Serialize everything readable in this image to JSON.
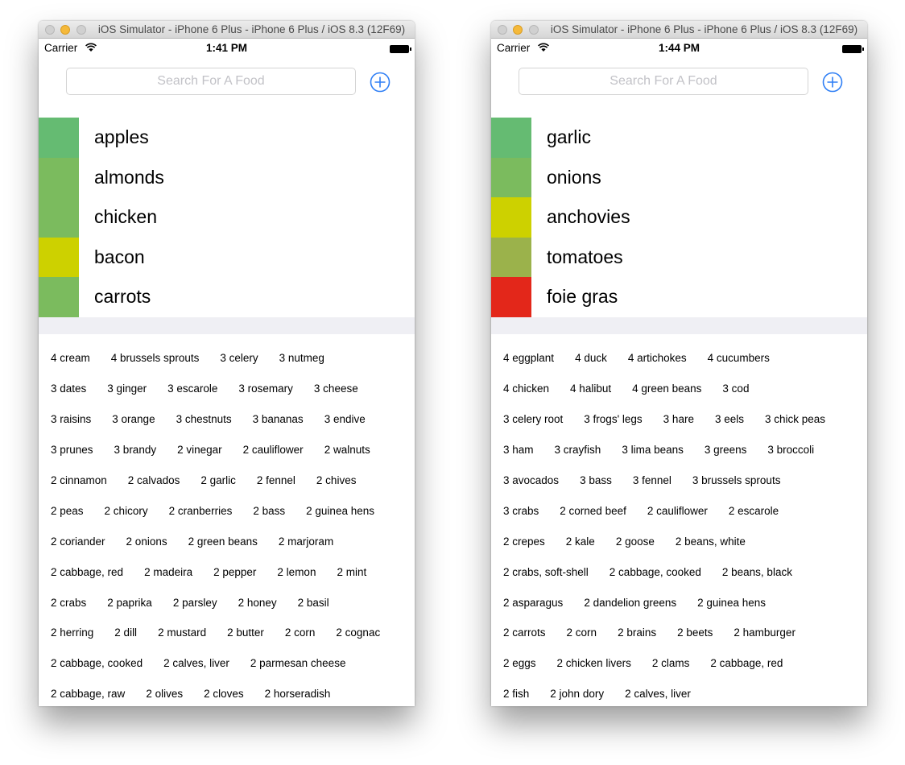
{
  "colors": {
    "green": "#66bb6a",
    "light_green": "#7cbb5c",
    "yellow": "#cdd100",
    "olive": "#9bb24b",
    "red": "#e3271a",
    "accent_blue": "#2f7ff5"
  },
  "left": {
    "window_title": "iOS Simulator - iPhone 6 Plus - iPhone 6 Plus / iOS 8.3 (12F69)",
    "carrier": "Carrier",
    "time": "1:41 PM",
    "search_placeholder": "Search For A Food",
    "foods": [
      {
        "name": "apples",
        "color": "#65bb72"
      },
      {
        "name": "almonds",
        "color": "#7bbb5e"
      },
      {
        "name": "chicken",
        "color": "#7bbb5e"
      },
      {
        "name": "bacon",
        "color": "#cdd100"
      },
      {
        "name": "carrots",
        "color": "#7bbb5e"
      }
    ],
    "suggestions": [
      [
        "4 cream",
        "4 brussels sprouts",
        "3 celery",
        "3 nutmeg"
      ],
      [
        "3 dates",
        "3 ginger",
        "3 escarole",
        "3 rosemary",
        "3 cheese"
      ],
      [
        "3 raisins",
        "3 orange",
        "3 chestnuts",
        "3 bananas",
        "3 endive"
      ],
      [
        "3 prunes",
        "3 brandy",
        "2 vinegar",
        "2 cauliflower",
        "2 walnuts"
      ],
      [
        "2 cinnamon",
        "2 calvados",
        "2 garlic",
        "2 fennel",
        "2 chives"
      ],
      [
        "2 peas",
        "2 chicory",
        "2 cranberries",
        "2 bass",
        "2 guinea hens"
      ],
      [
        "2 coriander",
        "2 onions",
        "2 green beans",
        "2 marjoram"
      ],
      [
        "2 cabbage, red",
        "2 madeira",
        "2 pepper",
        "2 lemon",
        "2 mint"
      ],
      [
        "2 crabs",
        "2 paprika",
        "2 parsley",
        "2 honey",
        "2 basil"
      ],
      [
        "2 herring",
        "2 dill",
        "2 mustard",
        "2 butter",
        "2 corn",
        "2 cognac"
      ],
      [
        "2 cabbage, cooked",
        "2 calves, liver",
        "2 parmesan cheese"
      ],
      [
        "2 cabbage, raw",
        "2 olives",
        "2 cloves",
        "2 horseradish"
      ]
    ]
  },
  "right": {
    "window_title": "iOS Simulator - iPhone 6 Plus - iPhone 6 Plus / iOS 8.3 (12F69)",
    "carrier": "Carrier",
    "time": "1:44 PM",
    "search_placeholder": "Search For A Food",
    "foods": [
      {
        "name": "garlic",
        "color": "#65bb72"
      },
      {
        "name": "onions",
        "color": "#7bbb5e"
      },
      {
        "name": "anchovies",
        "color": "#cdd100"
      },
      {
        "name": "tomatoes",
        "color": "#9bb24b"
      },
      {
        "name": "foie gras",
        "color": "#e3271a"
      }
    ],
    "suggestions": [
      [
        "4 eggplant",
        "4 duck",
        "4 artichokes",
        "4 cucumbers"
      ],
      [
        "4 chicken",
        "4 halibut",
        "4 green beans",
        "3 cod"
      ],
      [
        "3 celery root",
        "3 frogs' legs",
        "3 hare",
        "3 eels",
        "3 chick peas"
      ],
      [
        "3 ham",
        "3 crayfish",
        "3 lima beans",
        "3 greens",
        "3 broccoli"
      ],
      [
        "3 avocados",
        "3 bass",
        "3 fennel",
        "3 brussels sprouts"
      ],
      [
        "3 crabs",
        "2 corned beef",
        "2 cauliflower",
        "2 escarole"
      ],
      [
        "2 crepes",
        "2 kale",
        "2 goose",
        "2 beans, white"
      ],
      [
        "2 crabs, soft-shell",
        "2 cabbage, cooked",
        "2 beans, black"
      ],
      [
        "2 asparagus",
        "2 dandelion greens",
        "2 guinea hens"
      ],
      [
        "2 carrots",
        "2 corn",
        "2 brains",
        "2 beets",
        "2 hamburger"
      ],
      [
        "2 eggs",
        "2 chicken livers",
        "2 clams",
        "2 cabbage, red"
      ],
      [
        "2 fish",
        "2 john dory",
        "2 calves, liver"
      ]
    ]
  }
}
